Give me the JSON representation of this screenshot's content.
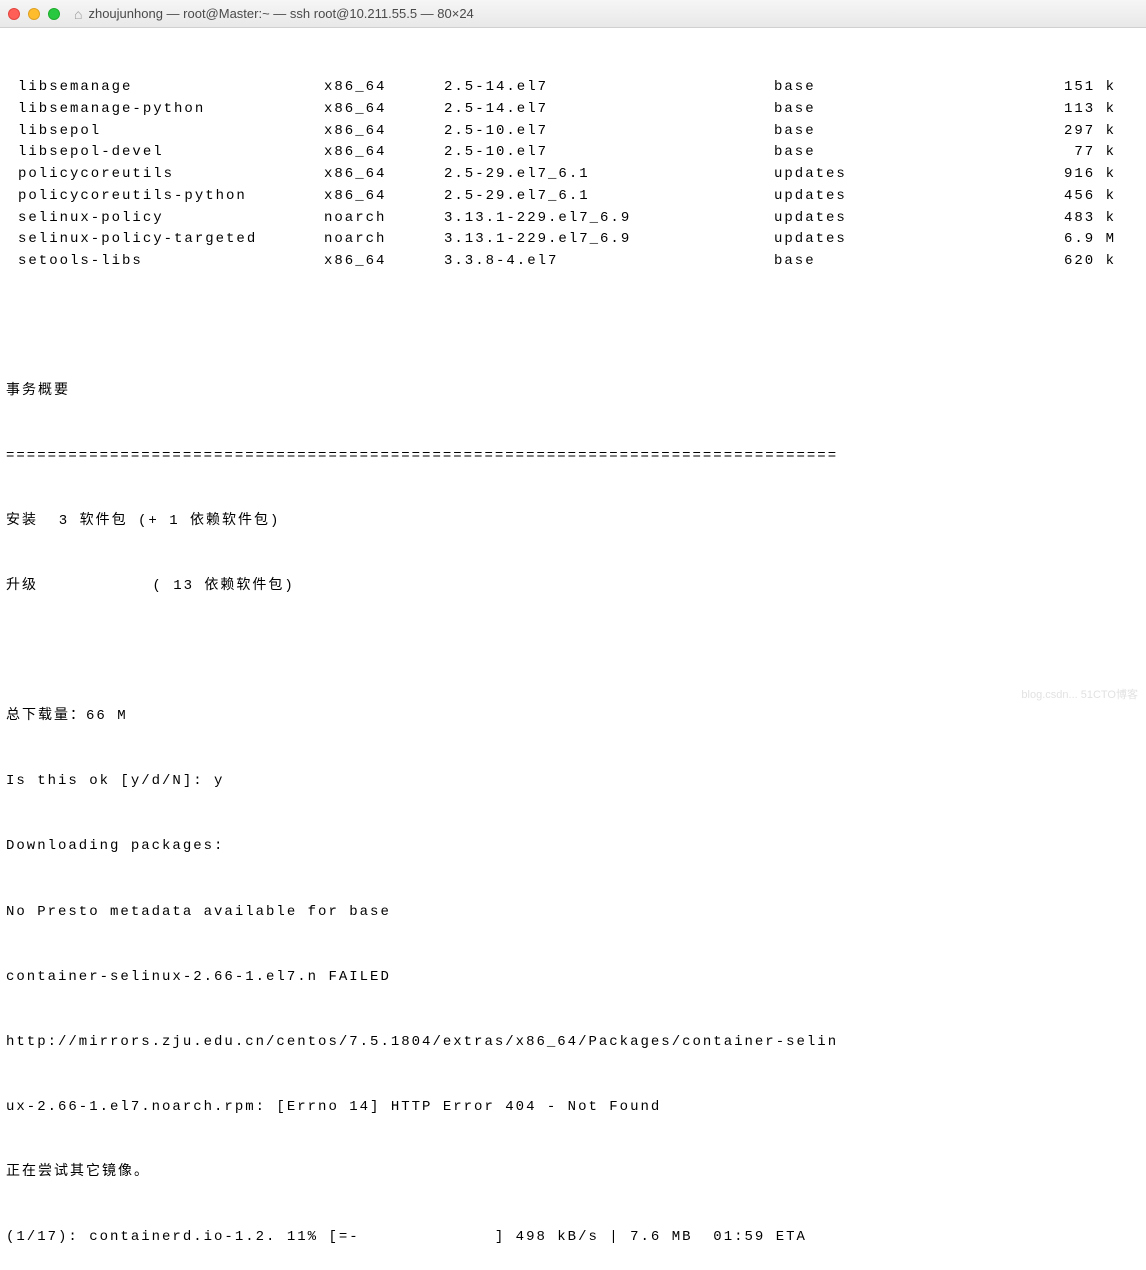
{
  "window": {
    "title": "zhoujunhong — root@Master:~ — ssh root@10.211.55.5 — 80×24"
  },
  "packages": [
    {
      "name": "libsemanage",
      "arch": "x86_64",
      "version": "2.5-14.el7",
      "repo": "base",
      "size": "151 k"
    },
    {
      "name": "libsemanage-python",
      "arch": "x86_64",
      "version": "2.5-14.el7",
      "repo": "base",
      "size": "113 k"
    },
    {
      "name": "libsepol",
      "arch": "x86_64",
      "version": "2.5-10.el7",
      "repo": "base",
      "size": "297 k"
    },
    {
      "name": "libsepol-devel",
      "arch": "x86_64",
      "version": "2.5-10.el7",
      "repo": "base",
      "size": "77 k"
    },
    {
      "name": "policycoreutils",
      "arch": "x86_64",
      "version": "2.5-29.el7_6.1",
      "repo": "updates",
      "size": "916 k"
    },
    {
      "name": "policycoreutils-python",
      "arch": "x86_64",
      "version": "2.5-29.el7_6.1",
      "repo": "updates",
      "size": "456 k"
    },
    {
      "name": "selinux-policy",
      "arch": "noarch",
      "version": "3.13.1-229.el7_6.9",
      "repo": "updates",
      "size": "483 k"
    },
    {
      "name": "selinux-policy-targeted",
      "arch": "noarch",
      "version": "3.13.1-229.el7_6.9",
      "repo": "updates",
      "size": "6.9 M"
    },
    {
      "name": "setools-libs",
      "arch": "x86_64",
      "version": "3.3.8-4.el7",
      "repo": "base",
      "size": "620 k"
    }
  ],
  "lines": {
    "blank": " ",
    "summary_title": "事务概要",
    "divider": "================================================================================",
    "install_line": "安装  3 软件包 (+ 1 依赖软件包)",
    "upgrade_line": "升级           ( 13 依赖软件包)",
    "total_dl": "总下载量：66 M",
    "confirm": "Is this ok [y/d/N]: y",
    "downloading": "Downloading packages:",
    "no_presto": "No Presto metadata available for base",
    "failed": "container-selinux-2.66-1.el7.n FAILED",
    "url1": "http://mirrors.zju.edu.cn/centos/7.5.1804/extras/x86_64/Packages/container-selin",
    "url2": "ux-2.66-1.el7.noarch.rpm: [Errno 14] HTTP Error 404 - Not Found",
    "trying": "正在尝试其它镜像。",
    "progress": "(1/17): containerd.io-1.2. 11% [=-             ] 498 kB/s | 7.6 MB  01:59 ETA"
  },
  "watermark": "blog.csdn... 51CTO博客"
}
